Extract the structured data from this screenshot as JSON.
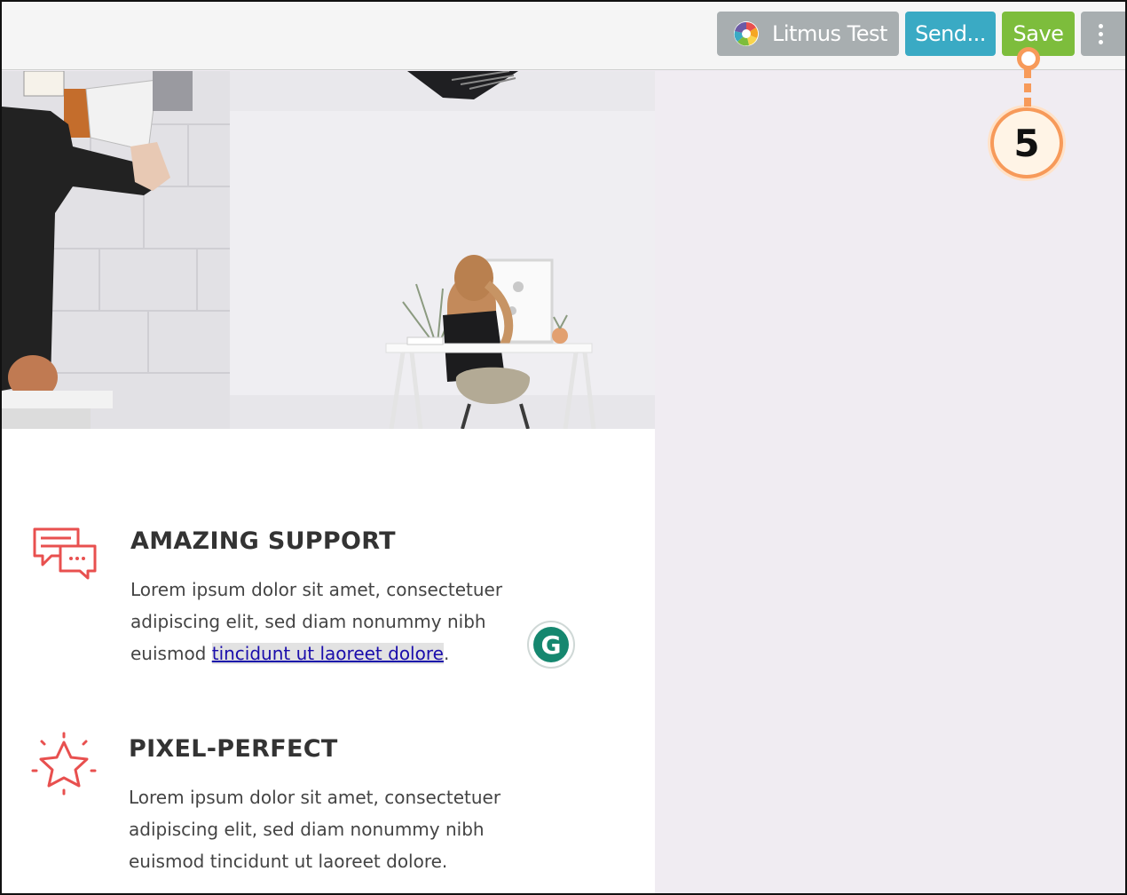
{
  "toolbar": {
    "litmus_label": "Litmus Test",
    "send_label": "Send...",
    "save_label": "Save",
    "more_icon": "kebab-vertical-icon"
  },
  "callout": {
    "number": "5",
    "color": "#f79a5a"
  },
  "colors": {
    "litmus_button": "#a8aeb0",
    "send_button": "#3aaac4",
    "save_button": "#7dbd3c",
    "accent_icon": "#e8504f",
    "canvas_background": "#f0ecf2"
  },
  "features": [
    {
      "icon": "chat-bubbles-icon",
      "title": "AMAZING SUPPORT",
      "text_before_link": "Lorem ipsum dolor sit amet, consectetuer adipiscing elit, sed diam nonummy nibh euismod ",
      "link_text": "tincidunt ut laoreet dolore",
      "text_after_link": "."
    },
    {
      "icon": "star-icon",
      "title": "PIXEL-PERFECT",
      "text": "Lorem ipsum dolor sit amet, consectetuer adipiscing elit, sed diam nonummy nibh euismod tincidunt ut laoreet dolore."
    }
  ],
  "grammarly": {
    "icon": "grammarly-icon",
    "letter": "G"
  }
}
